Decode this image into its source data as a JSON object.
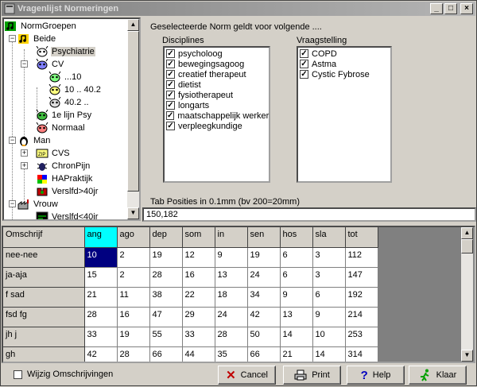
{
  "window": {
    "title": "Vragenlijst Normeringen",
    "buttons": [
      "_",
      "□",
      "×"
    ]
  },
  "tree": {
    "root": "NormGroepen",
    "nodes": [
      {
        "label": "Beide",
        "expander": "−"
      },
      {
        "label": "Psychiatrie"
      },
      {
        "label": "CV",
        "expander": "−"
      },
      {
        "label": "...10"
      },
      {
        "label": "10 .. 40.2"
      },
      {
        "label": "40.2 .."
      },
      {
        "label": "1e lijn Psy"
      },
      {
        "label": "Normaal"
      },
      {
        "label": "Man",
        "expander": "−"
      },
      {
        "label": "CVS",
        "expander": "+"
      },
      {
        "label": "ChronPijn",
        "expander": "+"
      },
      {
        "label": "HAPraktijk"
      },
      {
        "label": "Verslfd>40jr"
      },
      {
        "label": "Vrouw",
        "expander": "−"
      },
      {
        "label": "Verslfd<40jr"
      }
    ]
  },
  "right": {
    "title": "Geselecteerde Norm geldt voor volgende ....",
    "disciplines_label": "Disciplines",
    "disciplines": [
      "psycholoog",
      "bewegingsagoog",
      "creatief therapeut",
      "dietist",
      "fysiotherapeut",
      "longarts",
      "maatschappelijk werker",
      "verpleegkundige"
    ],
    "vraagstelling_label": "Vraagstelling",
    "vraagstelling": [
      "COPD",
      "Astma",
      "Cystic Fybrose"
    ],
    "tabpos_label": "Tab Posities in 0.1mm  (bv  200=20mm)",
    "tabpos_value": "150,182"
  },
  "grid": {
    "headers": [
      "Omschrijf",
      "ang",
      "ago",
      "dep",
      "som",
      "in",
      "sen",
      "hos",
      "sla",
      "tot"
    ],
    "rows": [
      [
        "nee-nee",
        "10",
        "2",
        "19",
        "12",
        "9",
        "19",
        "6",
        "3",
        "112"
      ],
      [
        "ja-aja",
        "15",
        "2",
        "28",
        "16",
        "13",
        "24",
        "6",
        "3",
        "147"
      ],
      [
        "f sad",
        "21",
        "11",
        "38",
        "22",
        "18",
        "34",
        "9",
        "6",
        "192"
      ],
      [
        "fsd fg",
        "28",
        "16",
        "47",
        "29",
        "24",
        "42",
        "13",
        "9",
        "214"
      ],
      [
        "jh j",
        "33",
        "19",
        "55",
        "33",
        "28",
        "50",
        "14",
        "10",
        "253"
      ],
      [
        "gh",
        "42",
        "28",
        "66",
        "44",
        "35",
        "66",
        "21",
        "14",
        "314"
      ]
    ]
  },
  "bottom": {
    "wijzig_label": "Wijzig Omschrijvingen",
    "cancel": "Cancel",
    "print": "Print",
    "help": "Help",
    "klaar": "Klaar"
  },
  "colors": {
    "highlight_header": "#00ffff",
    "selected_cell": "#000080",
    "cancel_icon": "#c00000",
    "klaar_icon": "#00a000"
  }
}
